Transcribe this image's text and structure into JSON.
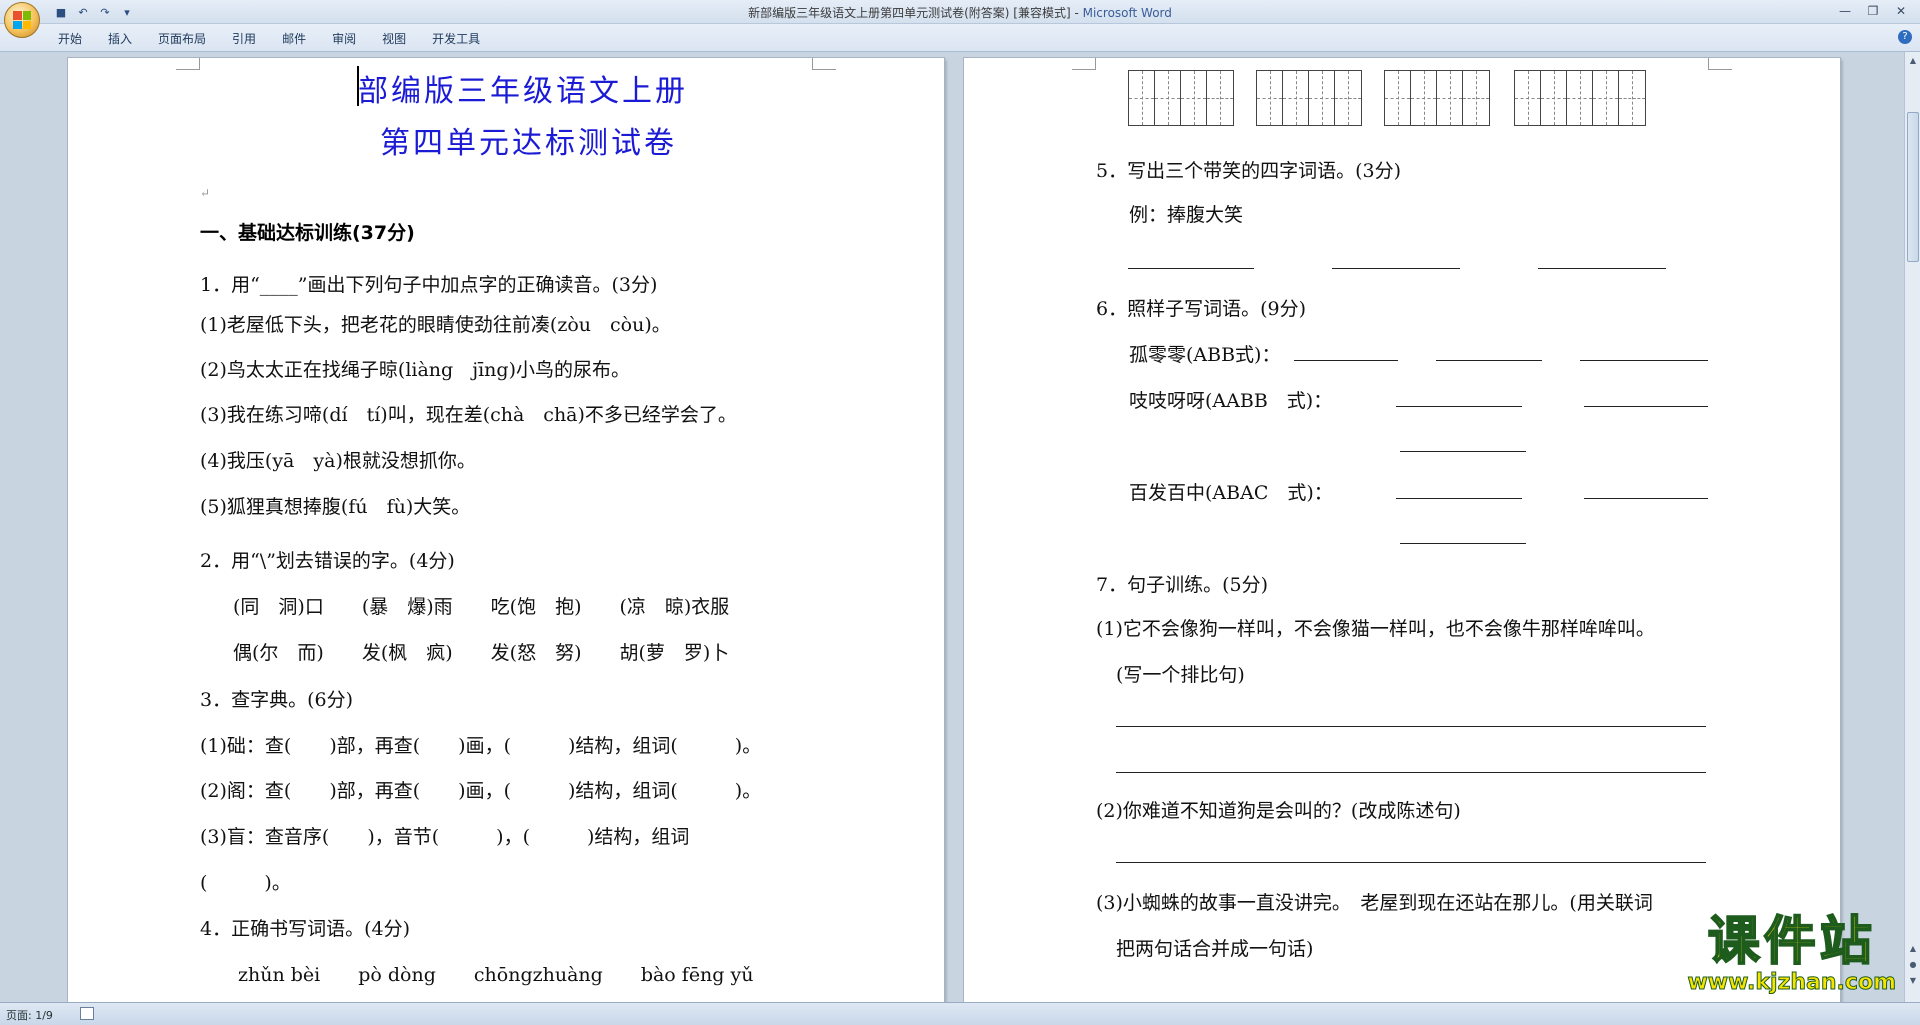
{
  "window": {
    "title": "新部编版三年级语文上册第四单元测试卷(附答案) [兼容模式] - ",
    "app_name": "Microsoft Word"
  },
  "ribbon": {
    "tabs": [
      "开始",
      "插入",
      "页面布局",
      "引用",
      "邮件",
      "审阅",
      "视图",
      "开发工具"
    ]
  },
  "status": {
    "page": "页面: 1/9"
  },
  "watermark": {
    "title": "课件站",
    "url": "www.kjzhan.com"
  },
  "left_page": {
    "title_line1": "部编版三年级语文上册",
    "title_line2": "第四单元达标测试卷",
    "section1": "一、基础达标训练(37分)",
    "q1": "1．用“____”画出下列句子中加点字的正确读音。(3分)",
    "q1_1": "(1)老屋低下头，把老花的眼睛使劲往前凑(zòu　còu)。",
    "q1_2": "(2)鸟太太正在找绳子晾(liàng　jīng)小鸟的尿布。",
    "q1_3": "(3)我在练习啼(dí　tí)叫，现在差(chà　chā)不多已经学会了。",
    "q1_4": "(4)我压(yā　yà)根就没想抓你。",
    "q1_5": "(5)狐狸真想捧腹(fú　fù)大笑。",
    "q2": "2．用“\\”划去错误的字。(4分)",
    "q2_row1": "(同　洞)口　　(暴　爆)雨　　吃(饱　抱)　　(凉　晾)衣服",
    "q2_row2": "偶(尔　而)　　发(枫　疯)　　发(怒　努)　　胡(萝　罗)卜",
    "q3": "3．查字典。(6分)",
    "q3_1": "(1)础：查(　　)部，再查(　　)画，(　　　)结构，组词(　　　)。",
    "q3_2": "(2)阁：查(　　)部，再查(　　)画，(　　　)结构，组词(　　　)。",
    "q3_3": "(3)盲：查音序(　　)，音节(　　　)，(　　　)结构，组词",
    "q3_3b": "(　　　)。",
    "q4": "4．正确书写词语。(4分)",
    "q4_pinyin": "zhǔn  bèi　　pò  dòng　　chōngzhuàng　　bào  fēng  yǔ"
  },
  "right_page": {
    "q5": "5．写出三个带笑的四字词语。(3分)",
    "q5_example": "例：捧腹大笑",
    "q6": "6．照样子写词语。(9分)",
    "q6_1": "孤零零(ABB式)：",
    "q6_2": "吱吱呀呀(AABB　式)：",
    "q6_3": "百发百中(ABAC　式)：",
    "q7": "7．句子训练。(5分)",
    "q7_1": "(1)它不会像狗一样叫，不会像猫一样叫，也不会像牛那样哞哞叫。",
    "q7_1b": "(写一个排比句)",
    "q7_2": "(2)你难道不知道狗是会叫的？(改成陈述句)",
    "q7_3": "(3)小蜘蛛的故事一直没讲完。　老屋到现在还站在那儿。(用关联词",
    "q7_3b": "把两句话合并成一句话)"
  }
}
